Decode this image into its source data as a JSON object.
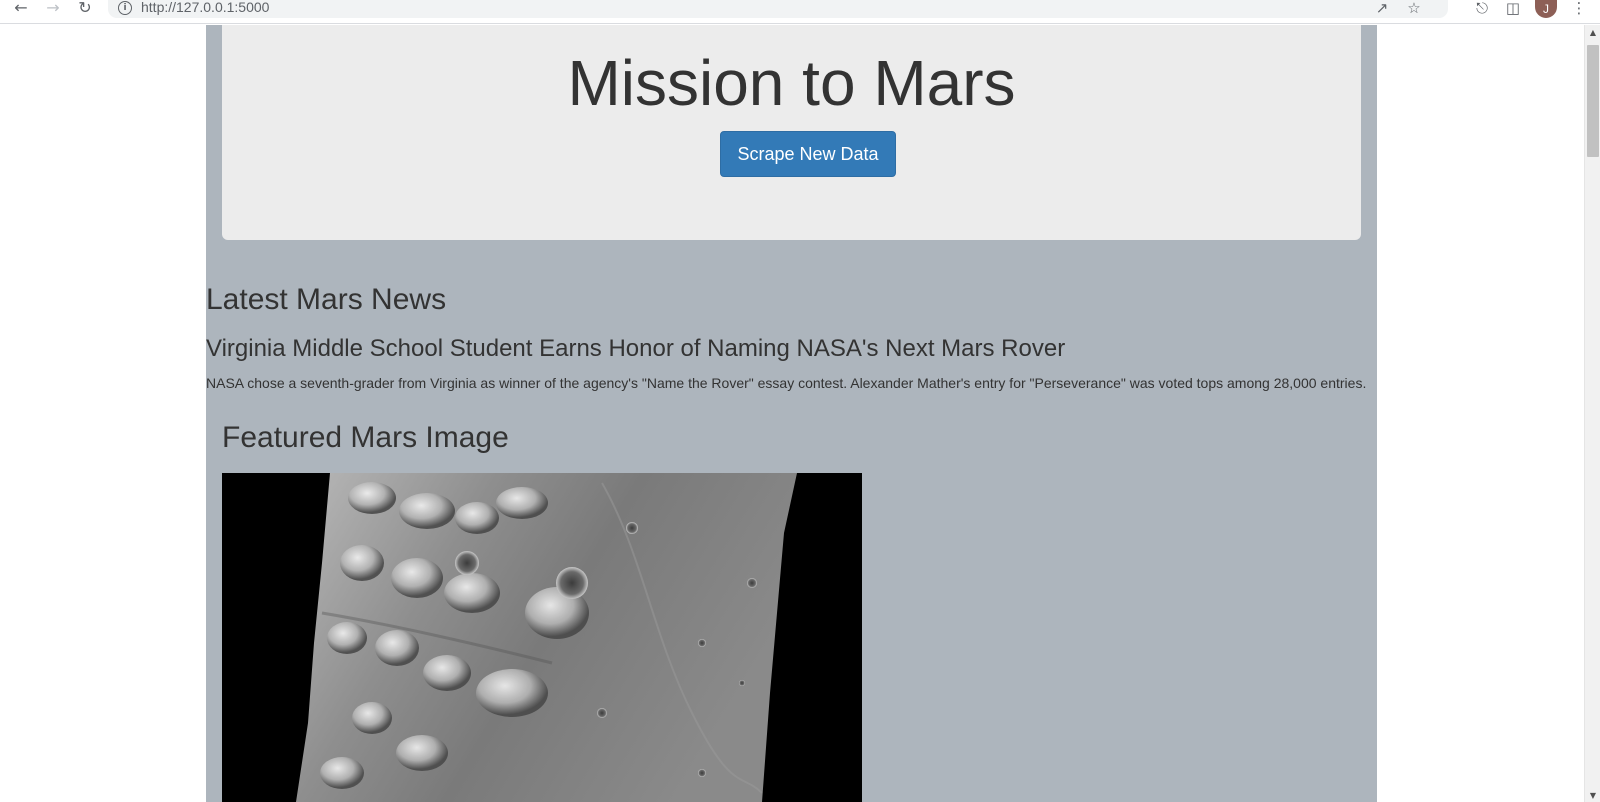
{
  "browser": {
    "url": "http://127.0.0.1:5000",
    "profile_initial": "J",
    "icons": {
      "back": "arrow-left-icon",
      "forward": "arrow-right-icon",
      "reload": "reload-icon",
      "site_info": "info-icon",
      "share": "share-icon",
      "bookmark": "star-icon",
      "extensions": "puzzle-icon",
      "side_panel": "side-panel-icon",
      "menu": "kebab-menu-icon"
    }
  },
  "jumbotron": {
    "title": "Mission to Mars",
    "scrape_button_label": "Scrape New Data"
  },
  "news": {
    "section_heading": "Latest Mars News",
    "title": "Virginia Middle School Student Earns Honor of Naming NASA's Next Mars Rover",
    "teaser": "NASA chose a seventh-grader from Virginia as winner of the agency's \"Name the Rover\" essay contest. Alexander Mather's entry for \"Perseverance\" was voted tops among 28,000 entries."
  },
  "featured": {
    "section_heading": "Featured Mars Image"
  },
  "colors": {
    "page_background": "#adb5bd",
    "jumbotron_background": "#ececec",
    "button_primary": "#337ab7",
    "text": "#333333"
  }
}
